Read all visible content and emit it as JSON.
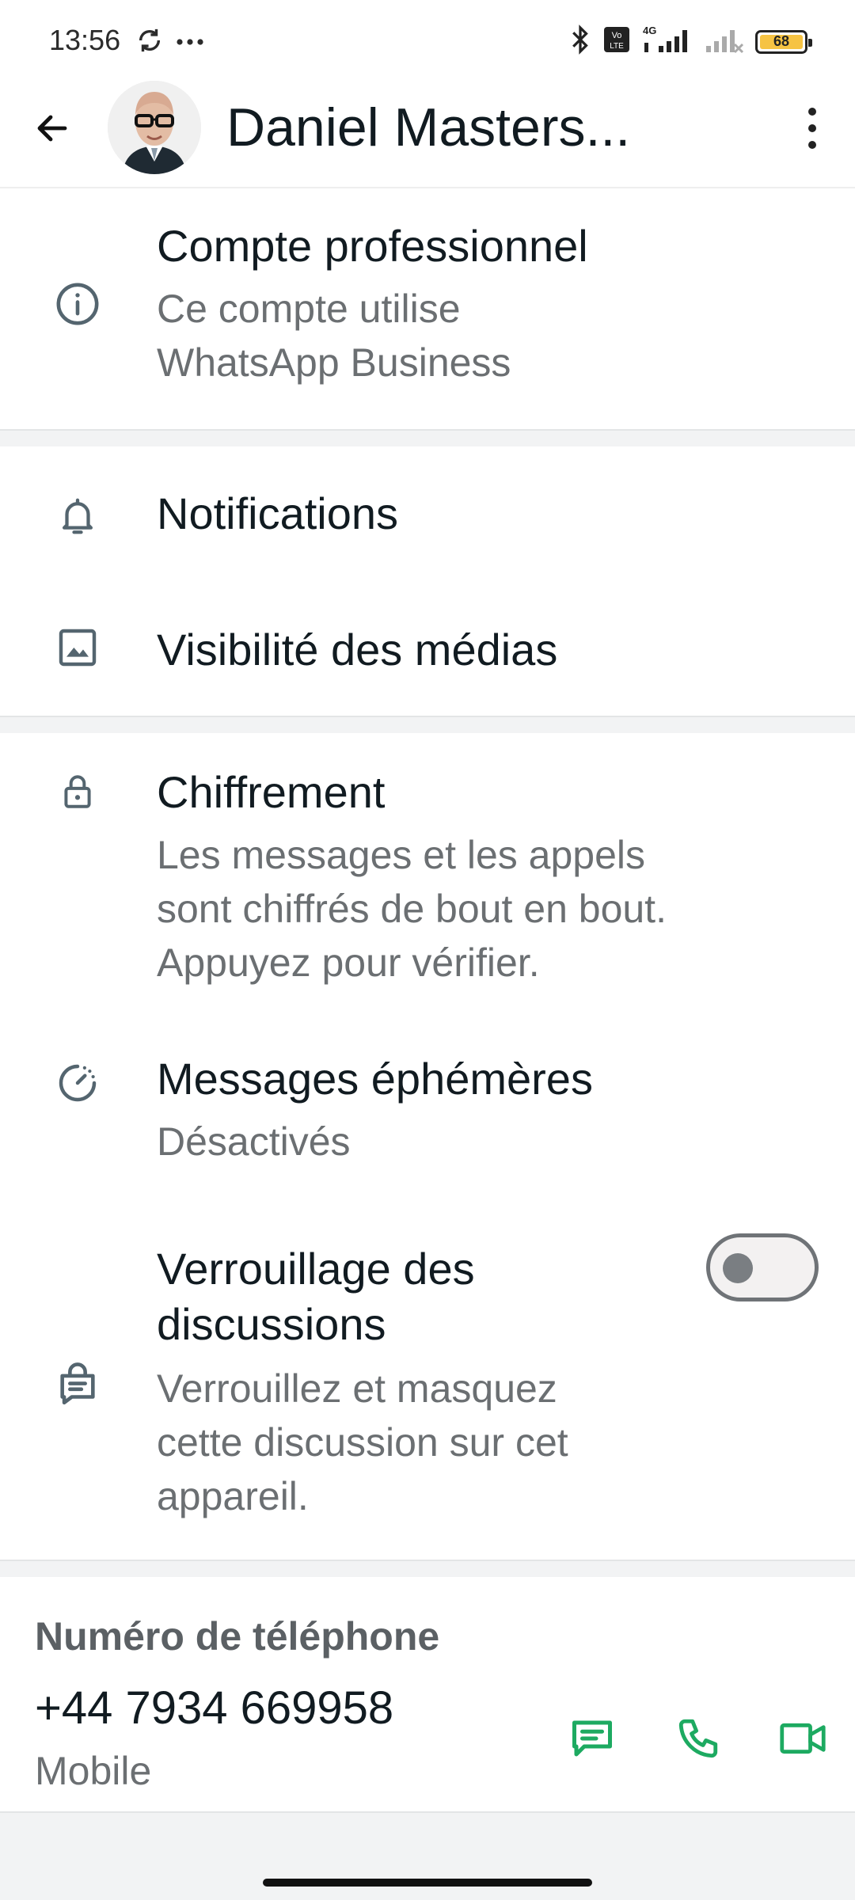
{
  "status_bar": {
    "time": "13:56",
    "battery_level": "68",
    "icons": [
      "sync-icon",
      "more-dots-icon",
      "bluetooth-icon",
      "volte-icon",
      "signal-icon",
      "signal-empty-icon",
      "battery-icon"
    ]
  },
  "header": {
    "contact_name": "Daniel Masters...",
    "back_icon": "back-arrow-icon",
    "menu_icon": "more-vertical-icon"
  },
  "business": {
    "title": "Compte professionnel",
    "subtitle_line1": "Ce compte utilise",
    "subtitle_line2": "WhatsApp Business",
    "icon": "info-icon"
  },
  "settings": {
    "notifications": "Notifications",
    "media_visibility": "Visibilité des médias"
  },
  "privacy": {
    "encryption_title": "Chiffrement",
    "encryption_line1": "Les messages et les appels",
    "encryption_line2": "sont chiffrés de bout en bout.",
    "encryption_line3": "Appuyez pour vérifier.",
    "ephemeral_title": "Messages éphémères",
    "ephemeral_value": "Désactivés",
    "lock_title_line1": "Verrouillage des",
    "lock_title_line2": "discussions",
    "lock_sub_line1": "Verrouillez et masquez",
    "lock_sub_line2": "cette discussion sur cet",
    "lock_sub_line3": "appareil.",
    "lock_enabled": false
  },
  "phone": {
    "label": "Numéro de téléphone",
    "number": "+44 7934 669958",
    "type": "Mobile",
    "actions": [
      "message-icon",
      "call-icon",
      "video-call-icon"
    ]
  },
  "colors": {
    "accent_green": "#1daa61",
    "text_primary": "#111b21",
    "text_secondary": "#6b6f72",
    "divider": "#e3e5e6"
  }
}
